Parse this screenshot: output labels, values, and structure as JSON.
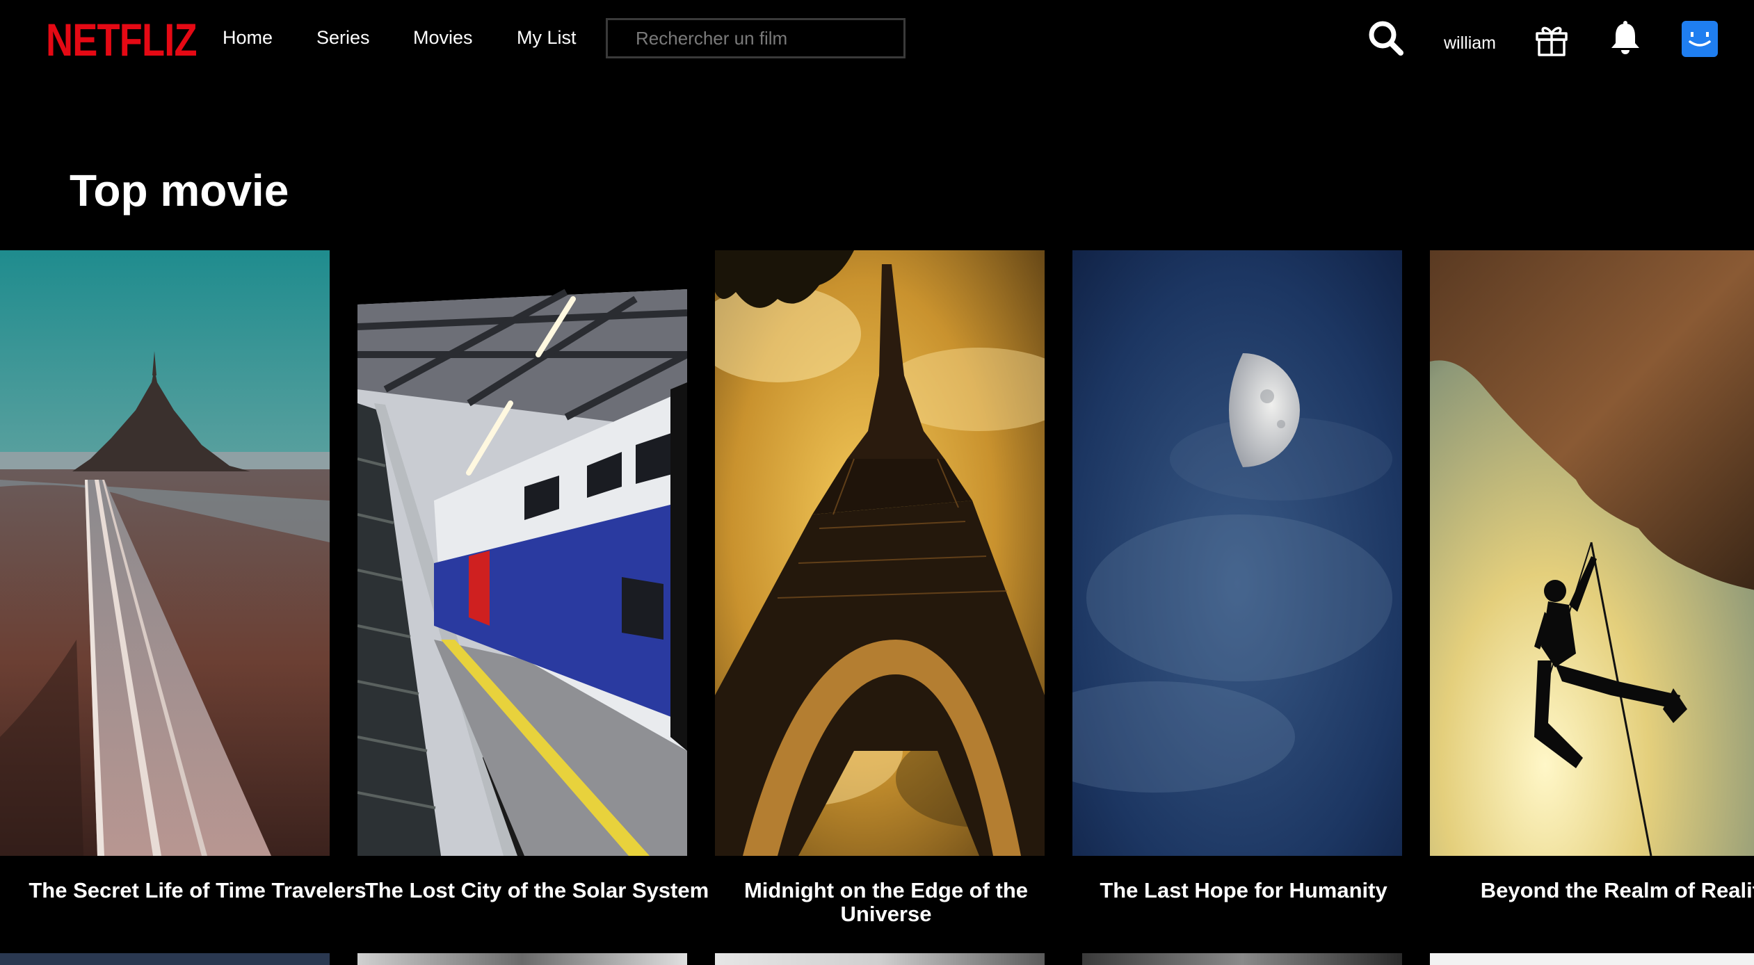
{
  "header": {
    "logo": "NETFLIZ",
    "nav": [
      "Home",
      "Series",
      "Movies",
      "My List"
    ],
    "search_placeholder": "Rechercher un film",
    "search_icon": "search-icon",
    "username": "william",
    "gift_icon": "gift-icon",
    "bell_icon": "bell-icon",
    "avatar_icon": "smiley-avatar-icon"
  },
  "section": {
    "title": "Top movie"
  },
  "movies": [
    {
      "title": "The Secret Life of Time Travelers"
    },
    {
      "title": "The Lost City of the Solar System"
    },
    {
      "title": "Midnight on the Edge of the Universe"
    },
    {
      "title": "The Last Hope for Humanity"
    },
    {
      "title": "Beyond the Realm of Reality"
    }
  ],
  "colors": {
    "background": "#000000",
    "brand_red": "#e50914",
    "avatar_blue": "#1f7ef0",
    "text": "#ffffff",
    "placeholder": "#7a7a7a"
  }
}
